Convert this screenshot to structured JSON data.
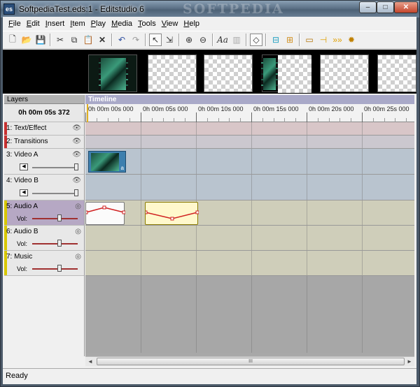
{
  "window": {
    "title": "SoftpediaTest.eds:1 - Editstudio 6",
    "app_icon_label": "es",
    "watermark": "SOFTPEDIA",
    "controls": {
      "minimize": "–",
      "maximize": "□",
      "close": "✕"
    }
  },
  "menubar": {
    "items": [
      {
        "label": "File",
        "key": "F",
        "rest": "ile"
      },
      {
        "label": "Edit",
        "key": "E",
        "rest": "dit"
      },
      {
        "label": "Insert",
        "key": "I",
        "rest": "nsert"
      },
      {
        "label": "Item",
        "key": "I",
        "rest": "tem"
      },
      {
        "label": "Play",
        "key": "P",
        "rest": "lay"
      },
      {
        "label": "Media",
        "key": "M",
        "rest": "edia"
      },
      {
        "label": "Tools",
        "key": "T",
        "rest": "ools"
      },
      {
        "label": "View",
        "key": "V",
        "rest": "iew"
      },
      {
        "label": "Help",
        "key": "H",
        "rest": "elp"
      }
    ]
  },
  "toolbar": {
    "icons": [
      "new-file-icon",
      "open-folder-icon",
      "save-icon",
      "cut-icon",
      "copy-icon",
      "paste-icon",
      "delete-icon",
      "undo-icon",
      "redo-icon",
      "select-pointer-icon",
      "select-range-icon",
      "zoom-in-icon",
      "zoom-out-icon",
      "text-tool-icon",
      "transition-tool-icon",
      "keyframe-icon",
      "align-left-icon",
      "align-right-icon",
      "render-icon",
      "split-icon",
      "arrows-icon",
      "settings-icon"
    ]
  },
  "layers_panel": {
    "header": "Layers",
    "current_time": "0h 00m 05s 372",
    "layers": [
      {
        "name": "1: Text/Effect",
        "color": "#c83030",
        "type": "text"
      },
      {
        "name": "2: Transitions",
        "color": "#c83030",
        "type": "trans"
      },
      {
        "name": "3: Video A",
        "color": "#3060a0",
        "type": "video"
      },
      {
        "name": "4: Video B",
        "color": "#3060a0",
        "type": "video"
      },
      {
        "name": "5: Audio A",
        "color": "#c8b400",
        "type": "audio",
        "vol_label": "Vol:",
        "selected": true
      },
      {
        "name": "6: Audio B",
        "color": "#c8b400",
        "type": "audio",
        "vol_label": "Vol:"
      },
      {
        "name": "7: Music",
        "color": "#c8b400",
        "type": "audio",
        "vol_label": "Vol:"
      }
    ]
  },
  "timeline": {
    "header": "Timeline",
    "ticks": [
      "0h 00m 00s 000",
      "0h 00m 05s 000",
      "0h 00m 10s 000",
      "0h 00m 15s 000",
      "0h 00m 20s 000",
      "0h 00m 25s 000"
    ],
    "video_clip_label": "a"
  },
  "hscroll": {
    "grip": "III",
    "left_arrow": "◄",
    "right_arrow": "►"
  },
  "status": {
    "text": "Ready"
  }
}
